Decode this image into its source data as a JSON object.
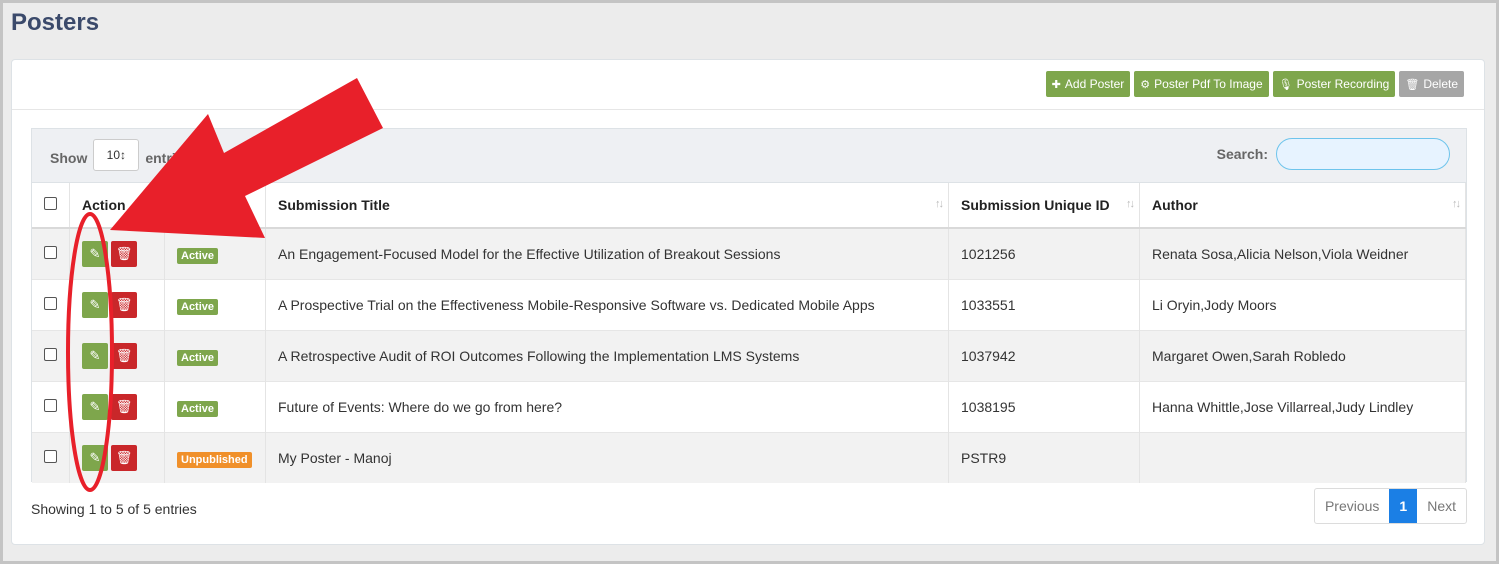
{
  "page": {
    "title": "Posters"
  },
  "toolbar": {
    "add_poster": "Add Poster",
    "pdf_to_image": "Poster Pdf To Image",
    "recording": "Poster Recording",
    "delete": "Delete"
  },
  "table_controls": {
    "show_label": "Show",
    "entries_value": "10",
    "entries_label": "entries",
    "search_label": "Search:",
    "search_value": ""
  },
  "columns": {
    "action": "Action",
    "title": "Submission Title",
    "uid": "Submission Unique ID",
    "author": "Author"
  },
  "rows": [
    {
      "status": "Active",
      "title": "An Engagement-Focused Model for the Effective Utilization of Breakout Sessions",
      "uid": "1021256",
      "author": "Renata Sosa,Alicia Nelson,Viola Weidner"
    },
    {
      "status": "Active",
      "title": "A Prospective Trial on the Effectiveness Mobile-Responsive Software vs. Dedicated Mobile Apps",
      "uid": "1033551",
      "author": "Li Oryin,Jody Moors"
    },
    {
      "status": "Active",
      "title": "A Retrospective Audit of ROI Outcomes Following the Implementation LMS Systems",
      "uid": "1037942",
      "author": "Margaret Owen,Sarah Robledo"
    },
    {
      "status": "Active",
      "title": "Future of Events: Where do we go from here?",
      "uid": "1038195",
      "author": "Hanna Whittle,Jose Villarreal,Judy Lindley"
    },
    {
      "status": "Unpublished",
      "title": "My Poster - Manoj",
      "uid": "PSTR9",
      "author": ""
    }
  ],
  "footer": {
    "showing": "Showing 1 to 5 of 5 entries",
    "previous": "Previous",
    "page": "1",
    "next": "Next"
  },
  "colors": {
    "accent_green": "#7ea64c",
    "danger_red": "#c9272a",
    "annotation_red": "#e8202a",
    "unpublished_orange": "#f0902a"
  }
}
